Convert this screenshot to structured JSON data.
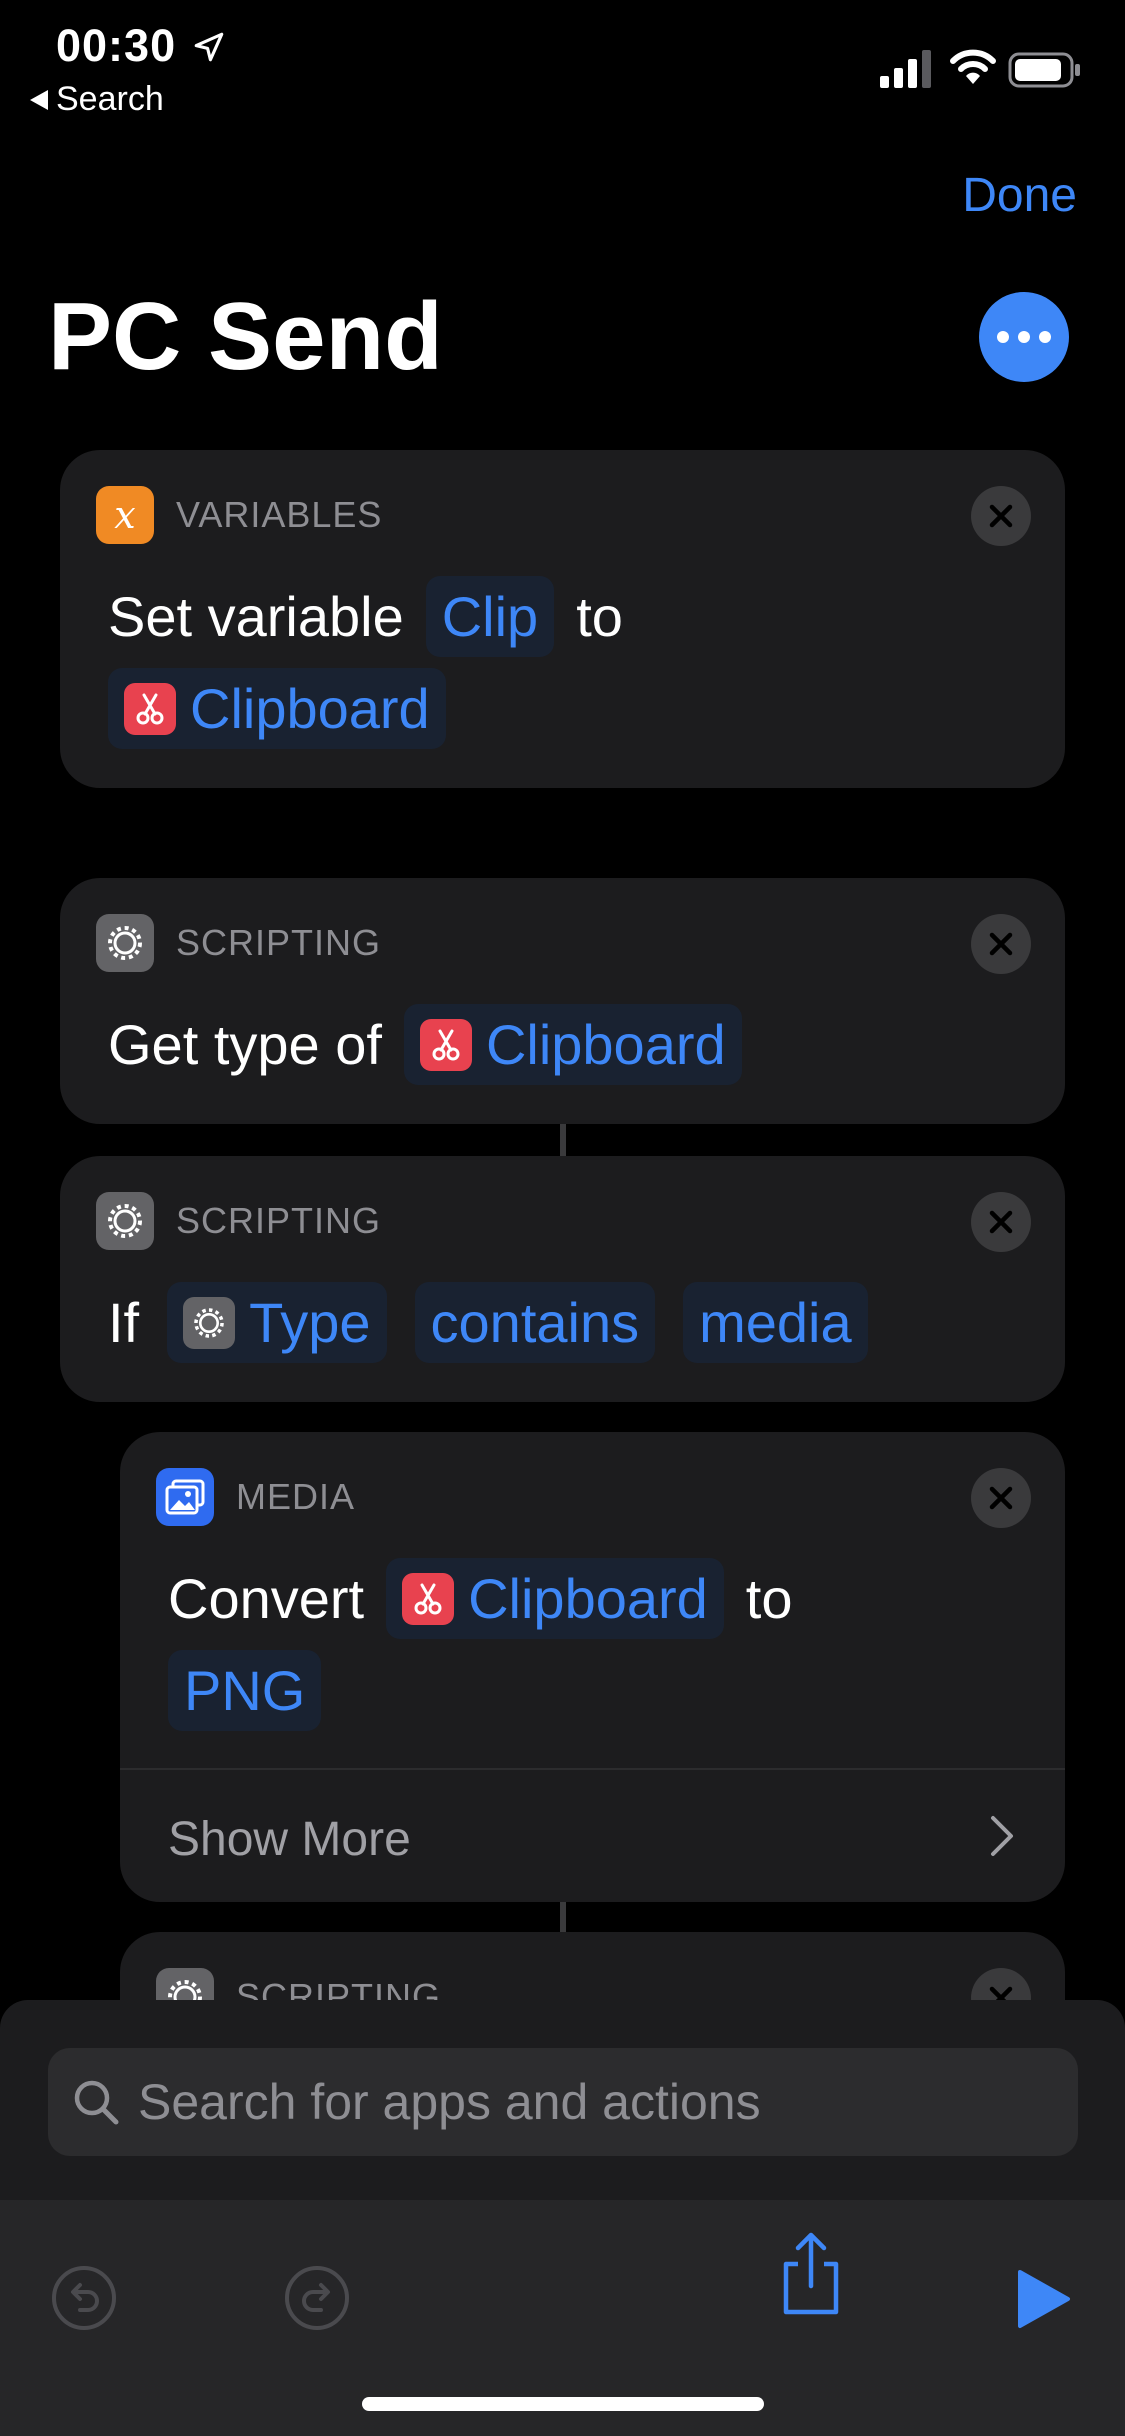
{
  "status_bar": {
    "time": "00:30",
    "back_label": "Search"
  },
  "header": {
    "done_label": "Done",
    "title": "PC Send"
  },
  "actions": [
    {
      "category": "VARIABLES",
      "words": [
        "Set variable",
        "to"
      ],
      "tokens": [
        "Clip",
        "Clipboard"
      ]
    },
    {
      "category": "SCRIPTING",
      "words": [
        "Get type of"
      ],
      "tokens": [
        "Clipboard"
      ]
    },
    {
      "category": "SCRIPTING",
      "words": [
        "If"
      ],
      "tokens": [
        "Type",
        "contains",
        "media"
      ]
    },
    {
      "category": "MEDIA",
      "words": [
        "Convert",
        "to"
      ],
      "tokens": [
        "Clipboard",
        "PNG"
      ],
      "show_more": "Show More"
    },
    {
      "category": "SCRIPTING"
    }
  ],
  "search": {
    "placeholder": "Search for apps and actions"
  },
  "colors": {
    "accent": "#3e87f7",
    "clipboard": "#e8424f",
    "variables": "#f08a24",
    "media": "#2f6bf0"
  },
  "icons": [
    "location-arrow-icon",
    "signal-icon",
    "wifi-icon",
    "battery-icon",
    "more-icon",
    "variable-icon",
    "scissors-icon",
    "gear-icon",
    "photo-icon",
    "close-icon",
    "chevron-right-icon",
    "search-icon",
    "undo-icon",
    "redo-icon",
    "share-icon",
    "play-icon"
  ]
}
